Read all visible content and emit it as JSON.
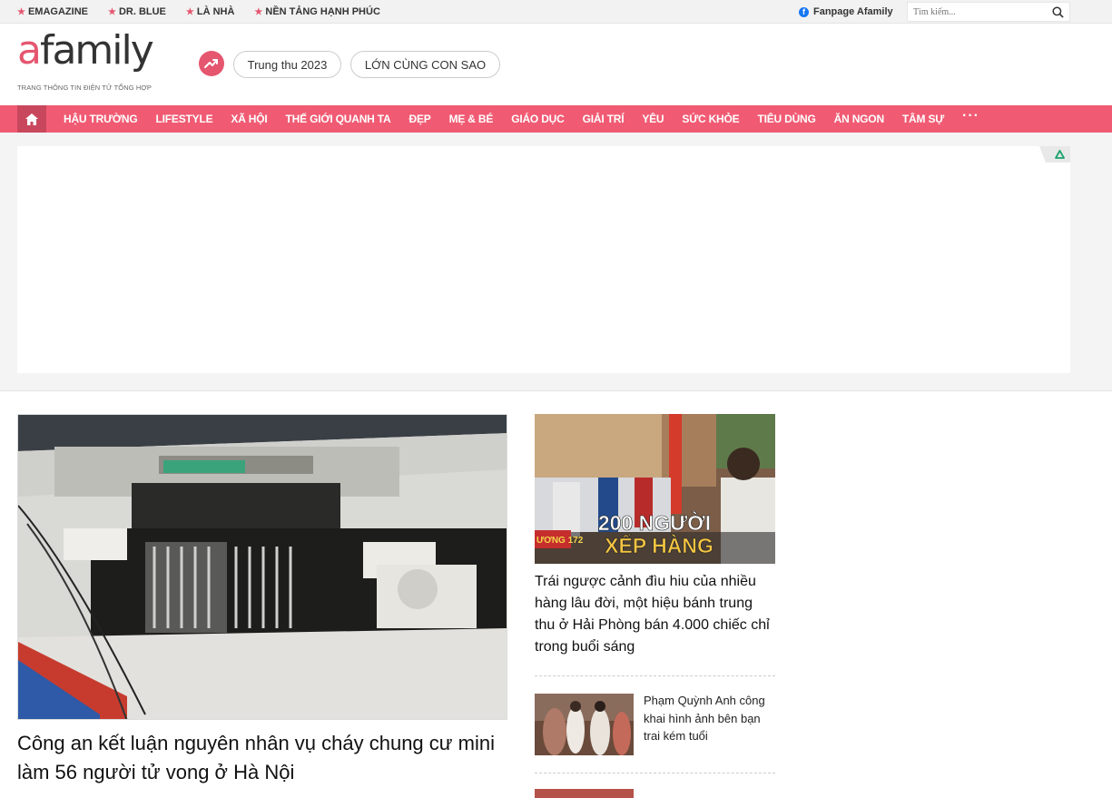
{
  "topbar": {
    "links": [
      {
        "label": "EMAGAZINE"
      },
      {
        "label": "DR. BLUE"
      },
      {
        "label": "LÀ NHÀ"
      },
      {
        "label": "NỀN TẢNG HẠNH PHÚC"
      }
    ],
    "fanpage_label": "Fanpage Afamily",
    "search_placeholder": "Tìm kiếm..."
  },
  "header": {
    "logo_accent": "a",
    "logo_rest": "family",
    "tagline": "TRANG THÔNG TIN ĐIỆN TỬ TỔNG HỢP",
    "trending": [
      "Trung thu 2023",
      "LỚN CÙNG CON SAO"
    ]
  },
  "nav": {
    "items": [
      "HẬU TRƯỜNG",
      "LIFESTYLE",
      "XÃ HỘI",
      "THẾ GIỚI QUANH TA",
      "ĐẸP",
      "MẸ & BÉ",
      "GIÁO DỤC",
      "GIẢI TRÍ",
      "YÊU",
      "SỨC KHỎE",
      "TIÊU DÙNG",
      "ĂN NGON",
      "TÂM SỰ"
    ],
    "more": "···"
  },
  "main_article": {
    "title": "Công an kết luận nguyên nhân vụ cháy chung cư mini làm 56 người tử vong ở Hà Nội"
  },
  "side_article": {
    "image_text_line1": "200 NGƯỜI",
    "image_text_line2": "XẾP HÀNG",
    "image_sign": "ƯƠNG 172",
    "title": "Trái ngược cảnh đìu hiu của nhiều hàng lâu đời, một hiệu bánh trung thu ở Hải Phòng bán 4.000 chiếc chỉ trong buổi sáng"
  },
  "small_article": {
    "title": "Phạm Quỳnh Anh công khai hình ảnh bên bạn trai kém tuổi"
  },
  "colors": {
    "brand": "#f05b73",
    "brand_dark": "#c9475d",
    "accent": "#e5566f"
  }
}
